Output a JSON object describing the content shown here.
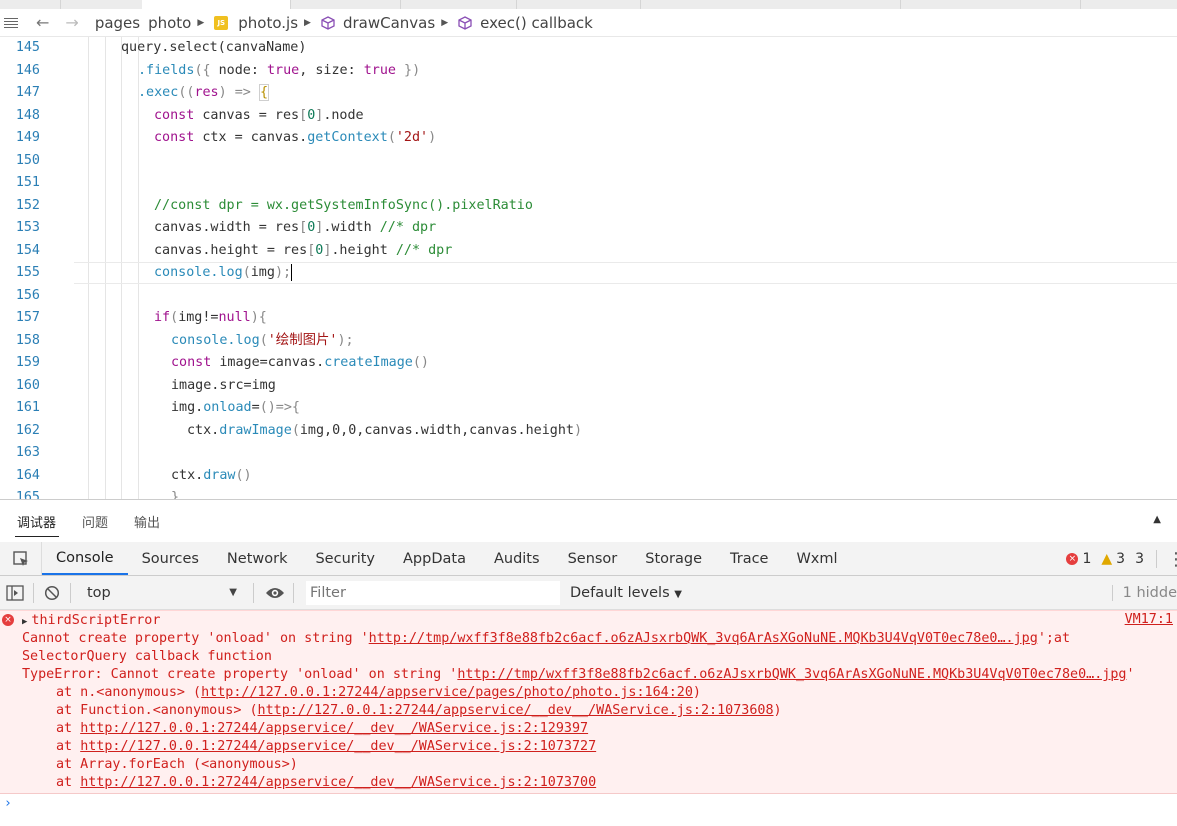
{
  "breadcrumb": {
    "items": [
      "pages",
      "photo",
      "photo.js",
      "drawCanvas",
      "exec() callback"
    ],
    "js_badge": "JS"
  },
  "editor": {
    "lines": [
      {
        "n": "145",
        "tokens": [
          [
            "v",
            "query.select(canvaName)"
          ]
        ]
      },
      {
        "n": "146",
        "tokens": [
          [
            "m",
            ".fields"
          ],
          [
            "p",
            "({"
          ],
          [
            "v",
            " node: "
          ],
          [
            "r",
            "true"
          ],
          [
            "v",
            ", size: "
          ],
          [
            "r",
            "true"
          ],
          [
            "p",
            " })"
          ]
        ]
      },
      {
        "n": "147",
        "tokens": [
          [
            "m",
            ".exec"
          ],
          [
            "p",
            "(("
          ],
          [
            "r",
            "res"
          ],
          [
            "p",
            ") => "
          ],
          [
            "b",
            "{"
          ]
        ]
      },
      {
        "n": "148",
        "tokens": [
          [
            "k",
            "const"
          ],
          [
            "v",
            " canvas = res"
          ],
          [
            "p",
            "["
          ],
          [
            "n",
            "0"
          ],
          [
            "p",
            "]"
          ],
          [
            "v",
            ".node"
          ]
        ]
      },
      {
        "n": "149",
        "tokens": [
          [
            "k",
            "const"
          ],
          [
            "v",
            " ctx = canvas."
          ],
          [
            "m",
            "getContext"
          ],
          [
            "p",
            "("
          ],
          [
            "s",
            "'2d'"
          ],
          [
            "p",
            ")"
          ]
        ]
      },
      {
        "n": "150",
        "tokens": []
      },
      {
        "n": "151",
        "tokens": []
      },
      {
        "n": "152",
        "tokens": [
          [
            "c",
            "//const dpr = wx.getSystemInfoSync().pixelRatio"
          ]
        ]
      },
      {
        "n": "153",
        "tokens": [
          [
            "v",
            "canvas.width = res"
          ],
          [
            "p",
            "["
          ],
          [
            "n",
            "0"
          ],
          [
            "p",
            "]"
          ],
          [
            "v",
            ".width "
          ],
          [
            "c",
            "//* dpr"
          ]
        ]
      },
      {
        "n": "154",
        "tokens": [
          [
            "v",
            "canvas.height = res"
          ],
          [
            "p",
            "["
          ],
          [
            "n",
            "0"
          ],
          [
            "p",
            "]"
          ],
          [
            "v",
            ".height "
          ],
          [
            "c",
            "//* dpr"
          ]
        ]
      },
      {
        "n": "155",
        "tokens": [
          [
            "m",
            "console.log"
          ],
          [
            "p",
            "("
          ],
          [
            "v",
            "img"
          ],
          [
            "p",
            ");"
          ]
        ]
      },
      {
        "n": "156",
        "tokens": []
      },
      {
        "n": "157",
        "tokens": [
          [
            "k",
            "if"
          ],
          [
            "p",
            "("
          ],
          [
            "v",
            "img!="
          ],
          [
            "r",
            "null"
          ],
          [
            "p",
            "){"
          ]
        ]
      },
      {
        "n": "158",
        "tokens": [
          [
            "m",
            "console.log"
          ],
          [
            "p",
            "("
          ],
          [
            "s",
            "'绘制图片'"
          ],
          [
            "p",
            ");"
          ]
        ]
      },
      {
        "n": "159",
        "tokens": [
          [
            "k",
            "const"
          ],
          [
            "v",
            " image=canvas."
          ],
          [
            "m",
            "createImage"
          ],
          [
            "p",
            "()"
          ]
        ]
      },
      {
        "n": "160",
        "tokens": [
          [
            "v",
            "image.src=img"
          ]
        ]
      },
      {
        "n": "161",
        "tokens": [
          [
            "v",
            "img."
          ],
          [
            "m",
            "onload"
          ],
          [
            "v",
            "="
          ],
          [
            "p",
            "()=>{"
          ]
        ]
      },
      {
        "n": "162",
        "tokens": [
          [
            "v",
            "ctx."
          ],
          [
            "m",
            "drawImage"
          ],
          [
            "p",
            "("
          ],
          [
            "v",
            "img,0,0,canvas.width,canvas.height"
          ],
          [
            "p",
            ")"
          ]
        ]
      },
      {
        "n": "163",
        "tokens": []
      },
      {
        "n": "164",
        "tokens": [
          [
            "v",
            "ctx."
          ],
          [
            "m",
            "draw"
          ],
          [
            "p",
            "()"
          ]
        ]
      },
      {
        "n": "165",
        "tokens": [
          [
            "p",
            "}"
          ]
        ]
      }
    ]
  },
  "panel": {
    "tabs": [
      "调试器",
      "问题",
      "输出"
    ]
  },
  "devtools": {
    "tabs": [
      "Console",
      "Sources",
      "Network",
      "Security",
      "AppData",
      "Audits",
      "Sensor",
      "Storage",
      "Trace",
      "Wxml"
    ],
    "error_count": "1",
    "warning_count": "3",
    "extra": "3"
  },
  "toolbar": {
    "context": "top",
    "filter_placeholder": "Filter",
    "levels": "Default levels",
    "hidden": "1 hidde"
  },
  "console": {
    "error_title": "thirdScriptError",
    "source": "VM17:1",
    "line2_prefix": "Cannot create property 'onload' on string '",
    "url_tmp": "http://tmp/wxff3f8e88fb2c6acf.o6zAJsxrbQWK_3vq6ArAsXGoNuNE.MQKb3U4VqV0T0ec78e0….jpg",
    "line2_suffix": "';at",
    "line3": "SelectorQuery callback function",
    "line4_prefix": "TypeError: Cannot create property 'onload' on string '",
    "line4_suffix": "'",
    "stack": [
      {
        "prefix": "at n.<anonymous> (",
        "url": "http://127.0.0.1:27244/appservice/pages/photo/photo.js:164:20",
        "suffix": ")"
      },
      {
        "prefix": "at Function.<anonymous> (",
        "url": "http://127.0.0.1:27244/appservice/__dev__/WAService.js:2:1073608",
        "suffix": ")"
      },
      {
        "prefix": "at ",
        "url": "http://127.0.0.1:27244/appservice/__dev__/WAService.js:2:129397",
        "suffix": ""
      },
      {
        "prefix": "at ",
        "url": "http://127.0.0.1:27244/appservice/__dev__/WAService.js:2:1073727",
        "suffix": ""
      },
      {
        "prefix": "at Array.forEach (<anonymous>)",
        "url": "",
        "suffix": ""
      },
      {
        "prefix": "at ",
        "url": "http://127.0.0.1:27244/appservice/__dev__/WAService.js:2:1073700",
        "suffix": ""
      }
    ]
  }
}
